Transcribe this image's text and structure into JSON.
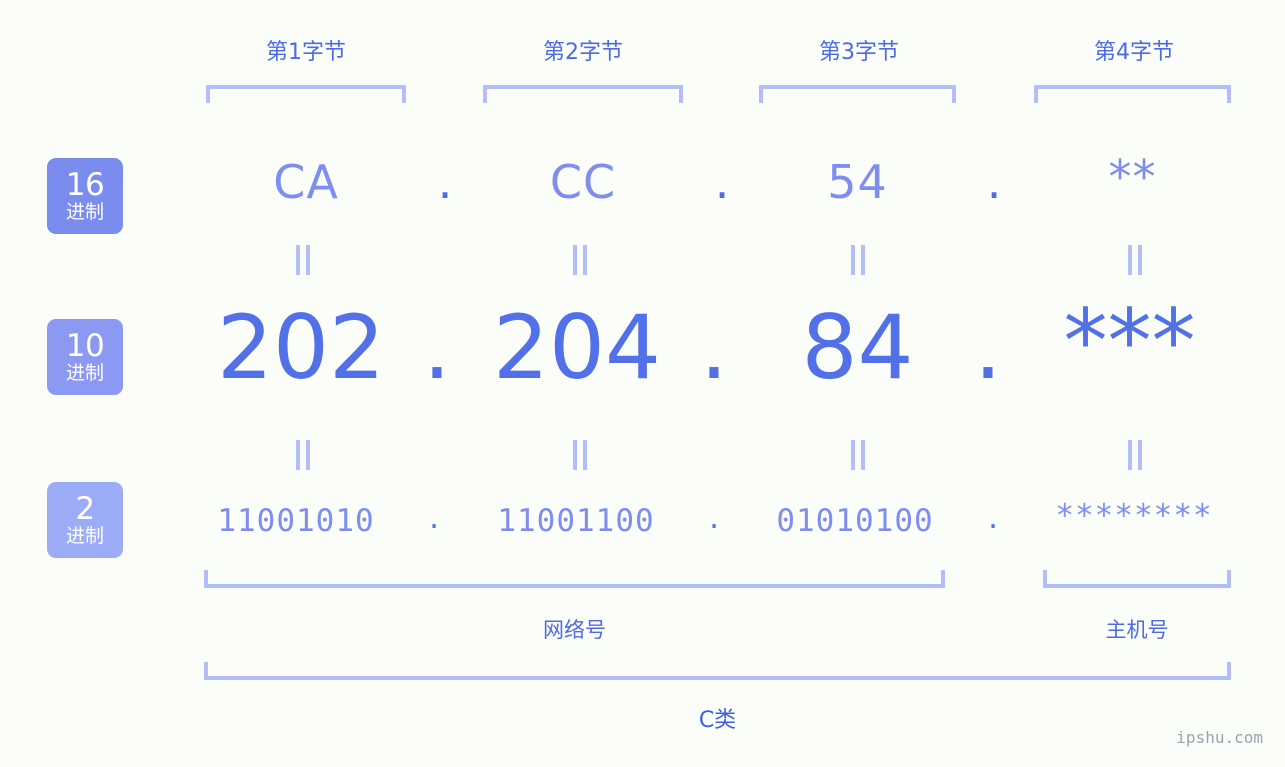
{
  "page": {
    "background_color": "#fbfdf8",
    "accent_color": "#5271e8",
    "light_accent_color": "#7e8ef0",
    "bracket_color": "#b3bdfa",
    "watermark": "ipshu.com"
  },
  "byte_headers": [
    {
      "label": "第1字节"
    },
    {
      "label": "第2字节"
    },
    {
      "label": "第3字节"
    },
    {
      "label": "第4字节"
    }
  ],
  "badges": [
    {
      "number": "16",
      "unit": "进制",
      "color": "#7b8cef"
    },
    {
      "number": "10",
      "unit": "进制",
      "color": "#8b99f2"
    },
    {
      "number": "2",
      "unit": "进制",
      "color": "#9dacf6"
    }
  ],
  "rows": {
    "hex": {
      "name": "hexadecimal",
      "values": [
        "CA",
        "CC",
        "54",
        "**"
      ],
      "separator": "."
    },
    "decimal": {
      "name": "decimal",
      "values": [
        "202",
        "204",
        "84",
        "***"
      ],
      "separator": "."
    },
    "binary": {
      "name": "binary",
      "values": [
        "11001010",
        "11001100",
        "01010100",
        "********"
      ],
      "separator": "."
    }
  },
  "equality_marks": {
    "glyph": "||",
    "count_per_row": 4
  },
  "sections": [
    {
      "label": "网络号"
    },
    {
      "label": "主机号"
    }
  ],
  "ip_class": {
    "label": "C类"
  }
}
